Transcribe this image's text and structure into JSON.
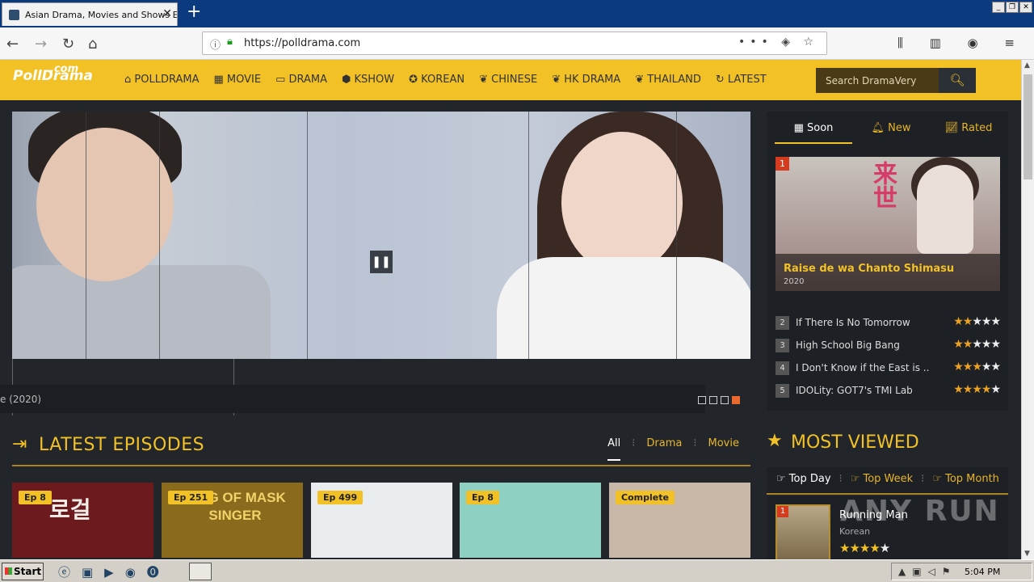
{
  "browser": {
    "tab_title": "Asian Drama, Movies and Shows E",
    "url": "https://polldrama.com"
  },
  "site": {
    "logo": "PollDrama",
    "logo_suffix": ".com",
    "menu": [
      {
        "icon": "home-icon",
        "label": "POLLDRAMA"
      },
      {
        "icon": "film-icon",
        "label": "MOVIE"
      },
      {
        "icon": "tv-icon",
        "label": "DRAMA"
      },
      {
        "icon": "hexagon-icon",
        "label": "KSHOW"
      },
      {
        "icon": "star-badge-icon",
        "label": "KOREAN"
      },
      {
        "icon": "leaf-icon",
        "label": "CHINESE"
      },
      {
        "icon": "leaf-icon",
        "label": "HK DRAMA"
      },
      {
        "icon": "leaf-icon",
        "label": "THAILAND"
      },
      {
        "icon": "refresh-icon",
        "label": "LATEST"
      }
    ],
    "search_placeholder": "Search DramaVery"
  },
  "slider": {
    "caption": "e (2020)",
    "dots": 4,
    "active_dot": 4
  },
  "sidebar": {
    "tabs": [
      {
        "icon": "calendar-icon",
        "label": "Soon"
      },
      {
        "icon": "bell-icon",
        "label": "New"
      },
      {
        "icon": "chart-icon",
        "label": "Rated"
      }
    ],
    "featured": {
      "rank": "1",
      "title": "Raise de wa Chanto Shimasu",
      "year": "2020"
    },
    "list": [
      {
        "rank": "2",
        "title": "If There Is No Tomorrow",
        "rating": 2
      },
      {
        "rank": "3",
        "title": "High School Big Bang",
        "rating": 2.5
      },
      {
        "rank": "4",
        "title": "I Don't Know if the East is ...",
        "rating": 3.5
      },
      {
        "rank": "5",
        "title": "IDOLity: GOT7's TMI Lab",
        "rating": 4
      }
    ]
  },
  "latest": {
    "title": "LATEST EPISODES",
    "filters": [
      "All",
      "Drama",
      "Movie"
    ],
    "cards": [
      {
        "badge": "Ep 8",
        "art": "로걸",
        "bg": "#6d1a1e"
      },
      {
        "badge": "Ep 251",
        "art": "KING OF MASK SINGER",
        "bg": "#8a6a1c"
      },
      {
        "badge": "Ep 499",
        "art": "",
        "bg": "#e8ecef"
      },
      {
        "badge": "Ep 8",
        "art": "",
        "bg": "#8ed0c2"
      },
      {
        "badge": "Complete",
        "art": "",
        "bg": "#c9b7a8"
      }
    ]
  },
  "most_viewed": {
    "title": "MOST VIEWED",
    "tabs": [
      "Top Day",
      "Top Week",
      "Top Month"
    ],
    "item": {
      "rank": "1",
      "title": "Running Man",
      "genre": "Korean",
      "rating": 4
    }
  },
  "watermark": "ANY RUN",
  "taskbar": {
    "start": "Start",
    "time": "5:04 PM"
  }
}
